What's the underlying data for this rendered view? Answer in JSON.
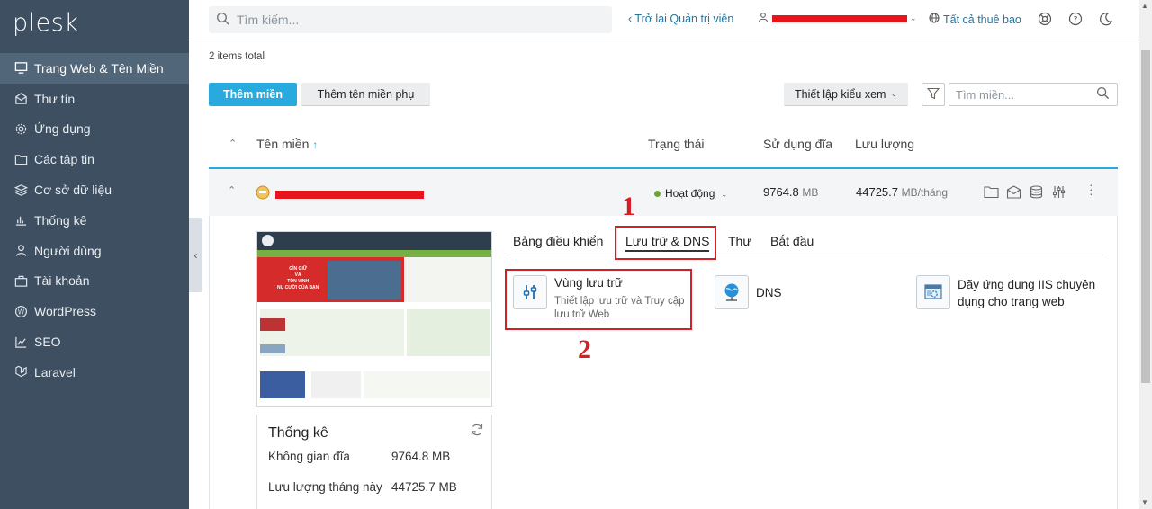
{
  "app": {
    "logo": "plesk"
  },
  "sidebar": {
    "items": [
      {
        "label": "Trang Web & Tên Miền",
        "icon": "monitor-icon",
        "active": true
      },
      {
        "label": "Thư tín",
        "icon": "mail-icon"
      },
      {
        "label": "Ứng dụng",
        "icon": "gear-icon"
      },
      {
        "label": "Các tập tin",
        "icon": "folder-icon"
      },
      {
        "label": "Cơ sở dữ liệu",
        "icon": "layers-icon"
      },
      {
        "label": "Thống kê",
        "icon": "bar-chart-icon"
      },
      {
        "label": "Người dùng",
        "icon": "user-icon"
      },
      {
        "label": "Tài khoản",
        "icon": "briefcase-icon"
      },
      {
        "label": "WordPress",
        "icon": "wordpress-icon"
      },
      {
        "label": "SEO",
        "icon": "seo-chart-icon"
      },
      {
        "label": "Laravel",
        "icon": "laravel-icon"
      }
    ],
    "collapse_glyph": "‹"
  },
  "topbar": {
    "search_placeholder": "Tìm kiếm...",
    "back_link": "Trở lại Quản trị viên",
    "subscriptions_link": "Tất cả thuê bao"
  },
  "toolbar": {
    "total": "2 items total",
    "add_domain": "Thêm miền",
    "add_subdomain": "Thêm tên miền phụ",
    "view_settings": "Thiết lập kiểu xem",
    "domain_search_placeholder": "Tìm miền..."
  },
  "table": {
    "headers": {
      "domain": "Tên miền",
      "status": "Trạng thái",
      "disk": "Sử dụng đĩa",
      "traffic": "Lưu lượng"
    },
    "row": {
      "status": "Hoạt động",
      "disk_value": "9764.8",
      "disk_unit": "MB",
      "traffic_value": "44725.7",
      "traffic_unit": "MB/tháng"
    }
  },
  "stats": {
    "title": "Thống kê",
    "disk_label": "Không gian đĩa",
    "disk_value": "9764.8 MB",
    "traffic_label": "Lưu lượng tháng này",
    "traffic_value": "44725.7 MB"
  },
  "tabs": [
    "Bảng điều khiển",
    "Lưu trữ & DNS",
    "Thư",
    "Bắt đầu"
  ],
  "tiles": {
    "storage": {
      "title": "Vùng lưu trữ",
      "desc": "Thiết lập lưu trữ và Truy cập lưu trữ Web"
    },
    "dns": {
      "title": "DNS"
    },
    "iis": {
      "title": "Dãy ứng dụng IIS chuyên dụng cho trang web"
    }
  },
  "annotations": {
    "one": "1",
    "two": "2"
  },
  "thumbnail": {
    "banner_line1": "GÌN GIỮ",
    "banner_line2": "VÀ",
    "banner_line3": "TÔN VINH",
    "banner_line4": "NỤ CƯỜI CỦA BẠN"
  },
  "colors": {
    "accent": "#28aade",
    "sidebar": "#3d4f60",
    "annotation": "#d31f26",
    "status_ok": "#6aa62f"
  }
}
